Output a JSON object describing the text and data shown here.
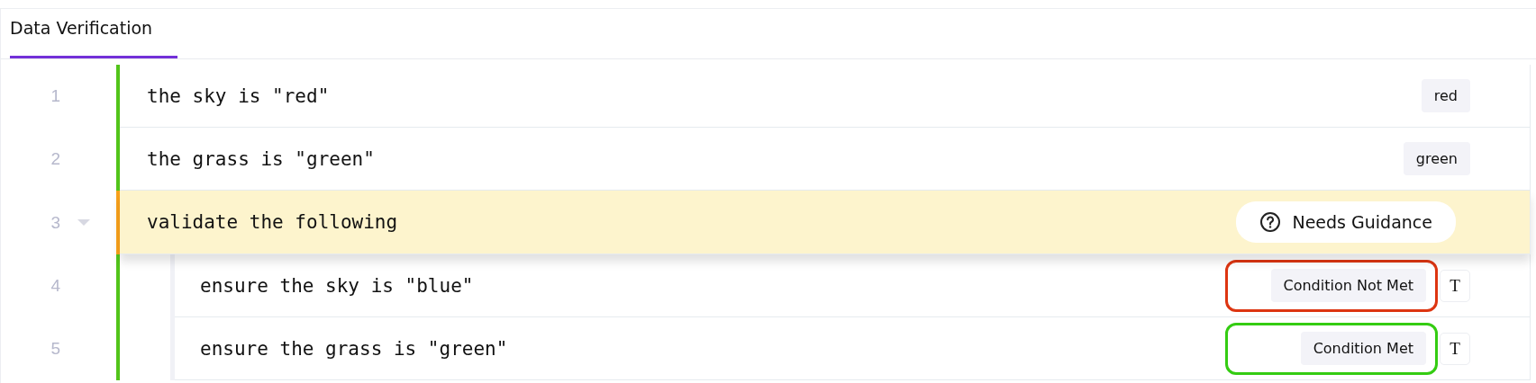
{
  "tabs": [
    {
      "label": "Data Verification",
      "selected": true
    }
  ],
  "rows": [
    {
      "number": "1",
      "text": "the sky is \"red\"",
      "color": "#52c41a",
      "tag": {
        "kind": "value",
        "label": "red"
      }
    },
    {
      "number": "2",
      "text": "the grass is \"green\"",
      "color": "#52c41a",
      "tag": {
        "kind": "value",
        "label": "green"
      }
    },
    {
      "number": "3",
      "text": "validate the following",
      "color": "#faa21b",
      "expanded": true,
      "tag": {
        "kind": "guidance",
        "label": "Needs Guidance"
      },
      "children": [
        {
          "number": "4",
          "text": "ensure the sky is \"blue\"",
          "color": "#52c41a",
          "tag": {
            "kind": "condition",
            "label": "Condition Not Met",
            "color": "#dd3511",
            "toggle": "T"
          }
        },
        {
          "number": "5",
          "text": "ensure the grass is \"green\"",
          "color": "#52c41a",
          "tag": {
            "kind": "condition",
            "label": "Condition Met",
            "color": "#34cc12",
            "toggle": "T"
          }
        }
      ]
    }
  ]
}
